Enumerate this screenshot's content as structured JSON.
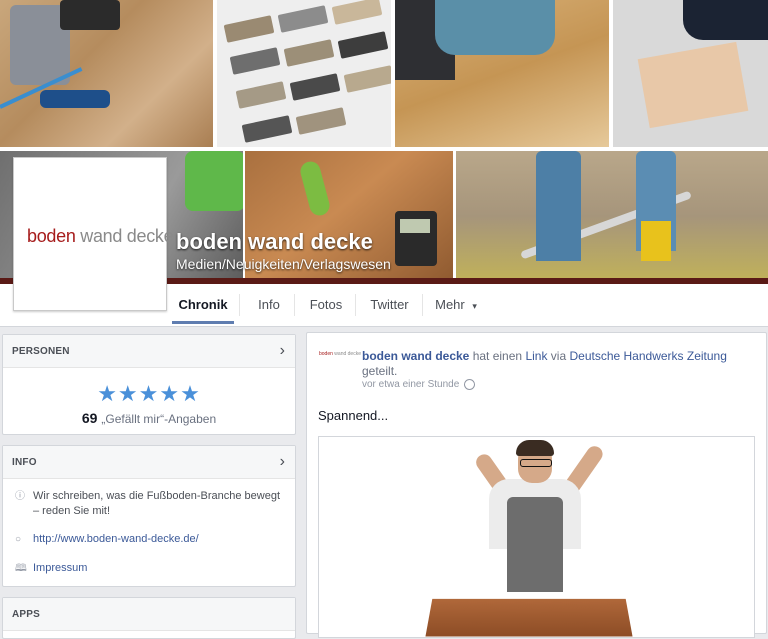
{
  "page": {
    "name": "boden wand decke",
    "category": "Medien/Neuigkeiten/Verlagswesen",
    "logo": {
      "part1": "boden",
      "part2": "wand decke"
    }
  },
  "nav": {
    "tabs": [
      {
        "label": "Chronik",
        "active": true
      },
      {
        "label": "Info"
      },
      {
        "label": "Fotos"
      },
      {
        "label": "Twitter"
      },
      {
        "label": "Mehr",
        "dropdown": true
      }
    ],
    "dropdown_glyph": "▾"
  },
  "sidebar": {
    "personen": {
      "heading": "PERSONEN",
      "rating_stars": 5,
      "stars_text": "★★★★★",
      "likes_count": "69",
      "likes_label": "„Gefällt mir“-Angaben"
    },
    "info": {
      "heading": "INFO",
      "description": "Wir schreiben, was die Fußboden-Branche bewegt – reden Sie mit!",
      "website": "http://www.boden-wand-decke.de/",
      "impressum": "Impressum"
    },
    "apps": {
      "heading": "APPS"
    }
  },
  "post": {
    "author": "boden wand decke",
    "action_pre": "hat einen",
    "action_link": "Link",
    "via_text": "via",
    "via_page": "Deutsche Handwerks Zeitung",
    "action_post": "geteilt.",
    "time": "vor etwa einer Stunde",
    "text": "Spannend...",
    "avatar_logo": {
      "part1": "boden",
      "part2": "wand decke"
    }
  },
  "colors": {
    "brand_red": "#a61c1c",
    "link_blue": "#3b5998",
    "star_blue": "#4a90d9",
    "page_bg": "#e9eaed"
  },
  "icons": {
    "chevron": "chevron-right-icon",
    "globe": "globe-icon",
    "info": "info-icon",
    "web": "web-icon",
    "book": "book-icon"
  }
}
